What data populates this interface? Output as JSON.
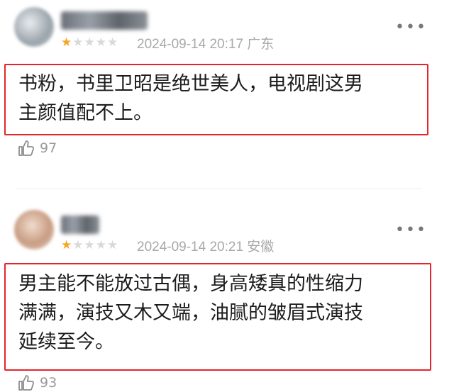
{
  "comments": [
    {
      "stars_filled": 1,
      "stars_total": 5,
      "datetime": "2024-09-14 20:17",
      "location": "广东",
      "text_lines": [
        "书粉，书里卫昭是绝世美人，电视剧这男",
        "主颜值配不上。"
      ],
      "likes": "97",
      "colors": {
        "highlight_border": "#e4252b",
        "star_on": "#f5a623"
      }
    },
    {
      "stars_filled": 1,
      "stars_total": 5,
      "datetime": "2024-09-14 20:21",
      "location": "安徽",
      "text_lines": [
        "男主能不能放过古偶，身高矮真的性缩力",
        "满满，演技又木又端，油腻的皱眉式演技",
        "延续至今。"
      ],
      "likes": "93",
      "colors": {
        "highlight_border": "#e4252b",
        "star_on": "#f5a623"
      }
    }
  ],
  "icons": {
    "more": "more-dots-icon",
    "like": "thumbs-up-icon",
    "star": "star-icon"
  },
  "more_glyph": "•••",
  "star_glyph": "★"
}
